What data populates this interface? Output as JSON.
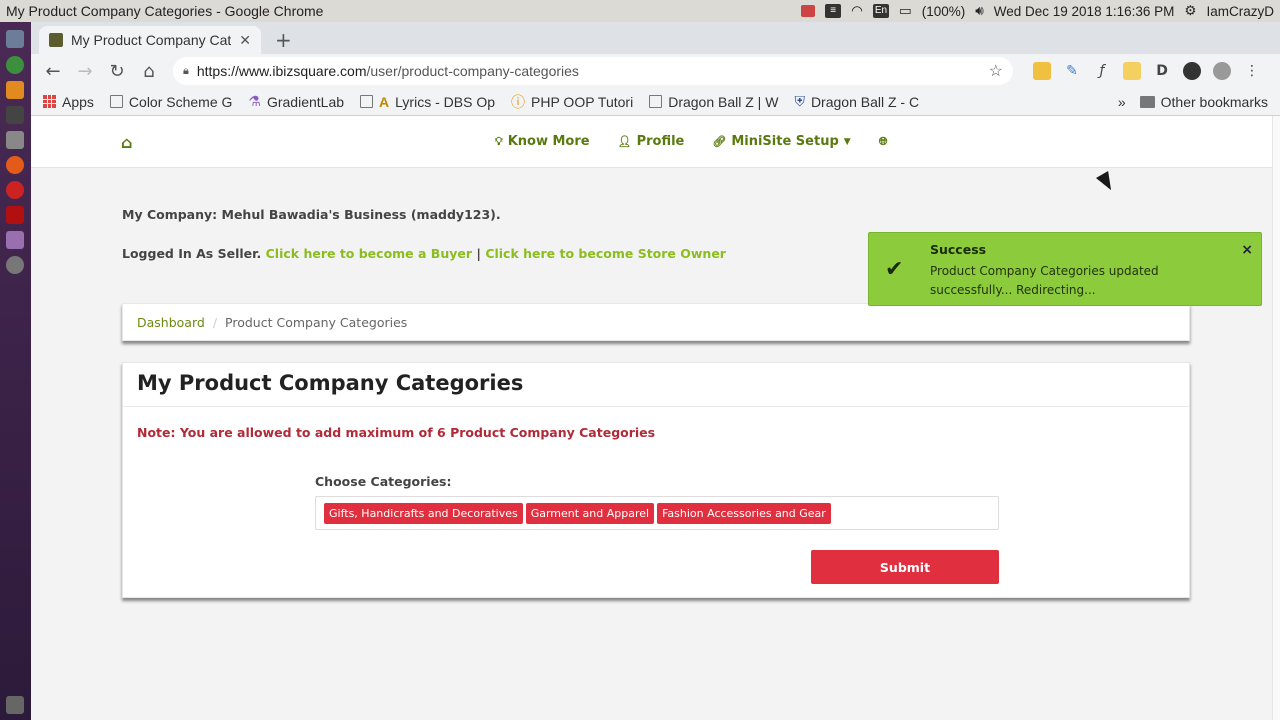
{
  "os": {
    "window_title": "My Product Company Categories - Google Chrome",
    "battery": "(100%)",
    "keyboard": "En",
    "clock": "Wed Dec 19 2018  1:16:36 PM",
    "user": "IamCrazyD"
  },
  "browser": {
    "tab_title": "My Product Company Cat",
    "url_host": "https://www.ibizsquare.com",
    "url_path": "/user/product-company-categories",
    "bookmarks": [
      "Apps",
      "Color Scheme G",
      "GradientLab",
      "Lyrics - DBS Op",
      "PHP OOP Tutori",
      "Dragon Ball Z | W",
      "Dragon Ball Z - C"
    ],
    "bookmarks_more": "»",
    "other_bookmarks": "Other bookmarks"
  },
  "nav": {
    "know_more": "Know More",
    "profile": "Profile",
    "minisite_setup": "MiniSite Setup"
  },
  "page": {
    "company": "My Company: Mehul Bawadia's Business (maddy123).",
    "logged_prefix": "Logged In As Seller.",
    "become_buyer": "Click here to become a Buyer",
    "separator": "|",
    "become_owner": "Click here to become Store Owner",
    "breadcrumb_home": "Dashboard",
    "breadcrumb_sep": "/",
    "breadcrumb_current": "Product Company Categories",
    "panel_title": "My Product Company Categories",
    "note": "Note: You are allowed to add maximum of 6 Product Company Categories",
    "choose_label": "Choose Categories:",
    "categories": [
      "Gifts, Handicrafts and Decoratives",
      "Garment and Apparel",
      "Fashion Accessories and Gear"
    ],
    "submit": "Submit"
  },
  "toast": {
    "title": "Success",
    "message": "Product Company Categories updated successfully... Redirecting...",
    "close": "×"
  },
  "colors": {
    "accent_green": "#8bbd1f",
    "nav_green": "#5a7a10",
    "danger_red": "#e03040",
    "toast_green": "#8ccc3c"
  }
}
